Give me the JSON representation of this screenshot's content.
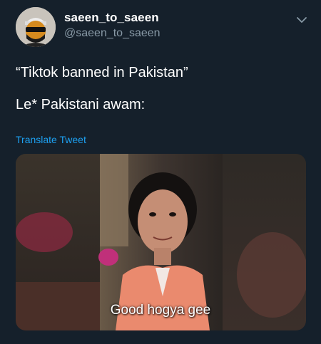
{
  "tweet": {
    "author": {
      "display_name": "saeen_to_saeen",
      "handle": "@saeen_to_saeen",
      "avatar_icon": "avatar-masked-figure"
    },
    "menu_icon": "chevron-down-icon",
    "text_lines": [
      "“Tiktok banned in Pakistan”",
      "Le* Pakistani awam:"
    ],
    "translate_label": "Translate Tweet",
    "media": {
      "caption": "Good hogya gee"
    }
  },
  "colors": {
    "background": "#15202b",
    "primary_text": "#ffffff",
    "secondary_text": "#8899a6",
    "link": "#1da1f2"
  }
}
